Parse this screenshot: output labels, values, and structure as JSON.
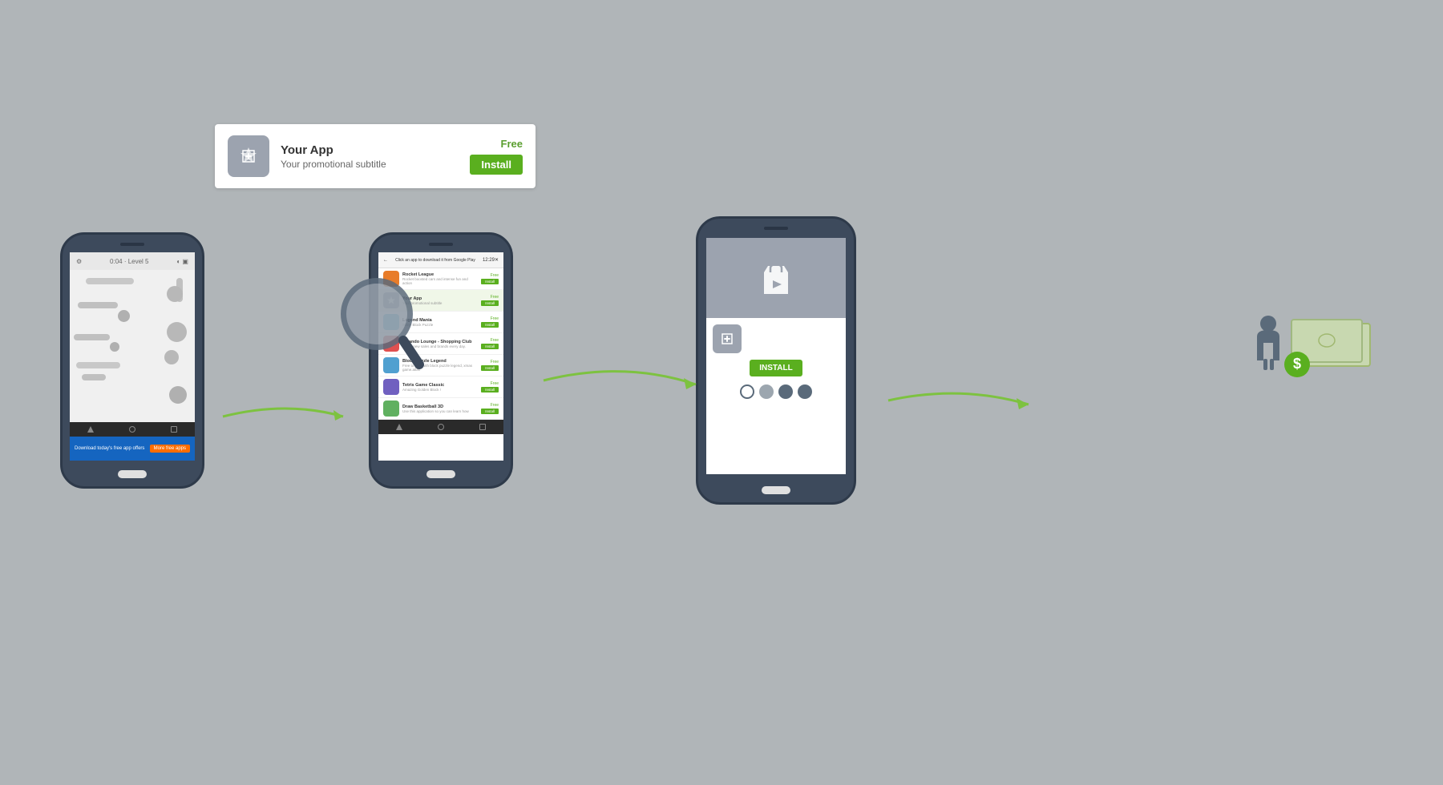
{
  "ad_banner": {
    "title": "Your App",
    "subtitle": "Your promotional subtitle",
    "price": "Free",
    "install_label": "Install"
  },
  "phone1": {
    "header": "0:04 · Level 5",
    "banner_text": "Download today's free app offers",
    "banner_btn": "More free apps"
  },
  "phone2": {
    "header_time": "12:29",
    "store_title": "Click an app to download it from Google Play",
    "apps": [
      {
        "name": "Rocket League",
        "desc": "Rocket boosted cars and intense fun and action",
        "price": "Free"
      },
      {
        "name": "Your App",
        "desc": "Your promotional subtitle",
        "price": "Free",
        "highlighted": true
      },
      {
        "name": "Legend Mania",
        "desc": "Shiny Block Puzzle",
        "price": "Free"
      },
      {
        "name": "Zalando Lounge - Shopping Club",
        "desc": "Offers new sales and brands every day.",
        "price": "Free"
      },
      {
        "name": "Block Puzzle Legend",
        "desc": "Free to play with block puzzle legend, xmas game.atlas",
        "price": "Free"
      },
      {
        "name": "Tetris Game Classic",
        "desc": "Amazing Golden Block !",
        "price": "Free"
      },
      {
        "name": "Draw Basketball 3D",
        "desc": "Use this application so you can learn how",
        "price": "Free"
      }
    ]
  },
  "phone3": {
    "install_label": "INSTALL"
  },
  "revenue": {
    "dollar_sign": "$"
  },
  "arrows": {
    "arrow1_label": "arrow-phone1-to-phone2",
    "arrow2_label": "arrow-phone2-to-phone3",
    "arrow3_label": "arrow-phone3-to-revenue"
  }
}
